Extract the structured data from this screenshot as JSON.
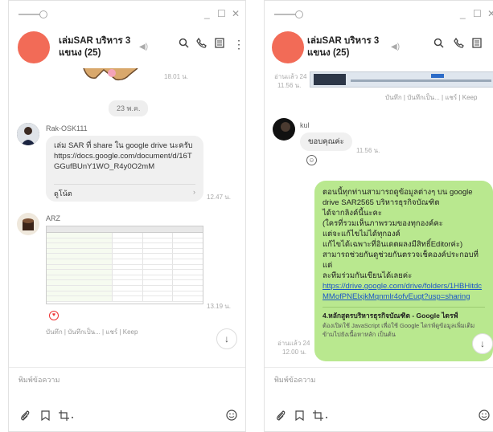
{
  "left": {
    "group_name": "เล่มSAR บริหาร 3 แขนง (25)",
    "top_timestamp": "18.01 น.",
    "date_divider": "23 พ.ค.",
    "msg1": {
      "sender": "Rak-OSK111",
      "text": "เล่ม SAR ที่ share ใน google drive นะครับ https://docs.google.com/document/d/16TGGufBUnY1WO_R4y0O2mM",
      "preview_label": "ดูโน้ต",
      "time": "12.47 น."
    },
    "msg2": {
      "sender": "ARZ",
      "time": "13.19 น.",
      "actions": "บันทึก | บันทึกเป็น... | แชร์ | Keep"
    },
    "placeholder": "พิมพ์ข้อความ"
  },
  "right": {
    "group_name": "เล่มSAR บริหาร 3 แขนง (25)",
    "top_read": "อ่านแล้ว 24",
    "top_time": "11.56 น.",
    "top_actions": "บันทึก | บันทึกเป็น... | แชร์ | Keep",
    "msg_kul": {
      "sender": "kul",
      "text": "ขอบคุณค่ะ",
      "time": "11.56 น."
    },
    "green": {
      "text1": "ตอนนี้ทุกท่านสามารถดูข้อมูลต่างๆ บน google drive SAR2565 บริหารธุรกิจบัณฑิต",
      "text2": "ได้จากลิงค์นี้นะคะ",
      "text3": "(ใครที่รวมเห็นภาพรวมของทุกองค์คะ",
      "text4": "แต่จะแก้ไขไม่ได้ทุกองค์",
      "text5": "แก้ไขได้เฉพาะที่อินเดตผลงมีสิทธิ์Editorค่ะ)",
      "text6": "สามารถช่วยกันดูช่วยกันตรวจเช็คองค์ประกอบที่แต่",
      "text7": "ละทีมร่วมกันเขียนได้เลยค่ะ",
      "link": "https://drive.google.com/drive/folders/1HBHitdcMMofPNElxjkMqnmlr4ofvEuqt?usp=sharing",
      "card_title": "4.หลักสูตรบริหารธุรกิจบัณฑิต - Google ไดรฟ์",
      "card_desc": "ต้องเปิดใช้ JavaScript เพื่อใช้ Google ไดรฟ์ดูข้อมูลเพิ่มเติม ข้ามไปยังเนื้อหาหลัก เป็นต้น"
    },
    "read_status": "อ่านแล้ว 24",
    "read_time": "12.00 น.",
    "placeholder": "พิมพ์ข้อความ"
  },
  "icons": [
    "pin-icon",
    "minimize-icon",
    "maximize-icon",
    "close-icon",
    "speaker-icon",
    "search-icon",
    "phone-icon",
    "notes-icon",
    "more-icon",
    "attach-icon",
    "bookmark-icon",
    "crop-icon",
    "emoji-icon",
    "scroll-down-icon",
    "read-check-icon"
  ],
  "colors": {
    "avatar": "#f26b57",
    "green_bubble": "#b9e88f",
    "link": "#1a55c8"
  }
}
